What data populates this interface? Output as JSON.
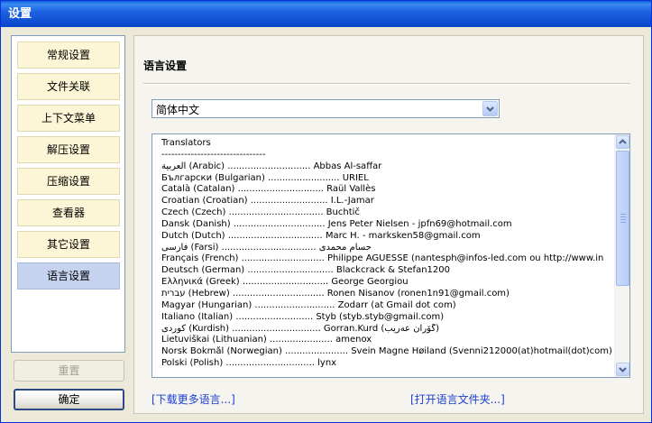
{
  "window": {
    "title": "设置"
  },
  "sidebar": {
    "items": [
      {
        "label": "常规设置"
      },
      {
        "label": "文件关联"
      },
      {
        "label": "上下文菜单"
      },
      {
        "label": "解压设置"
      },
      {
        "label": "压缩设置"
      },
      {
        "label": "查看器"
      },
      {
        "label": "其它设置"
      },
      {
        "label": "语言设置",
        "active": true
      }
    ]
  },
  "buttons": {
    "reset_label": "重置",
    "ok_label": "确定"
  },
  "panel": {
    "title": "语言设置",
    "language_select": {
      "value": "简体中文"
    },
    "translators": [
      "Translators",
      "--------------------------------",
      "العربية (Arabic) ............................. Abbas Al-saffar",
      "Български (Bulgarian) ......................... URIEL",
      "Català (Catalan) .............................. Raül Vallès",
      "Croatian (Croatian) ........................... I.L.-Jamar",
      "Czech (Czech) ................................. Buchtič",
      "Dansk (Danish) ................................ Jens Peter Nielsen - jpfn69@hotmail.com",
      "Dutch (Dutch) ................................. Marc H. - marksken58@gmail.com",
      "فارسی (Farsi) ................................. حسام محمدی",
      "Français (French) ............................. Philippe AGUESSE (nantesph@infos-led.com ou http://www.in",
      "Deutsch (German) .............................. Blackcrack & Stefan1200",
      "Ελληνικά (Greek) .............................. George Georgiou",
      "עברית (Hebrew) ................................ Ronen Nisanov (ronen1n91@gmail.com)",
      "Magyar (Hungarian) ............................ Zodarr (at Gmail dot com)",
      "Italiano (Italian) ........................... Styb (styb.styb@gmail.com)",
      "كوردی (Kurdish) ............................... Gorran.Kurd (گۆران عەریب)",
      "Lietuviškai (Lithuanian) ...................... amenox",
      "Norsk Bokmål (Norwegian) ...................... Svein Magne Høiland (Svenni212000(at)hotmail(dot)com)",
      "Polski (Polish) ............................... lynx"
    ],
    "download_link": "[下载更多语言...]",
    "open_folder_link": "[打开语言文件夹...]"
  }
}
